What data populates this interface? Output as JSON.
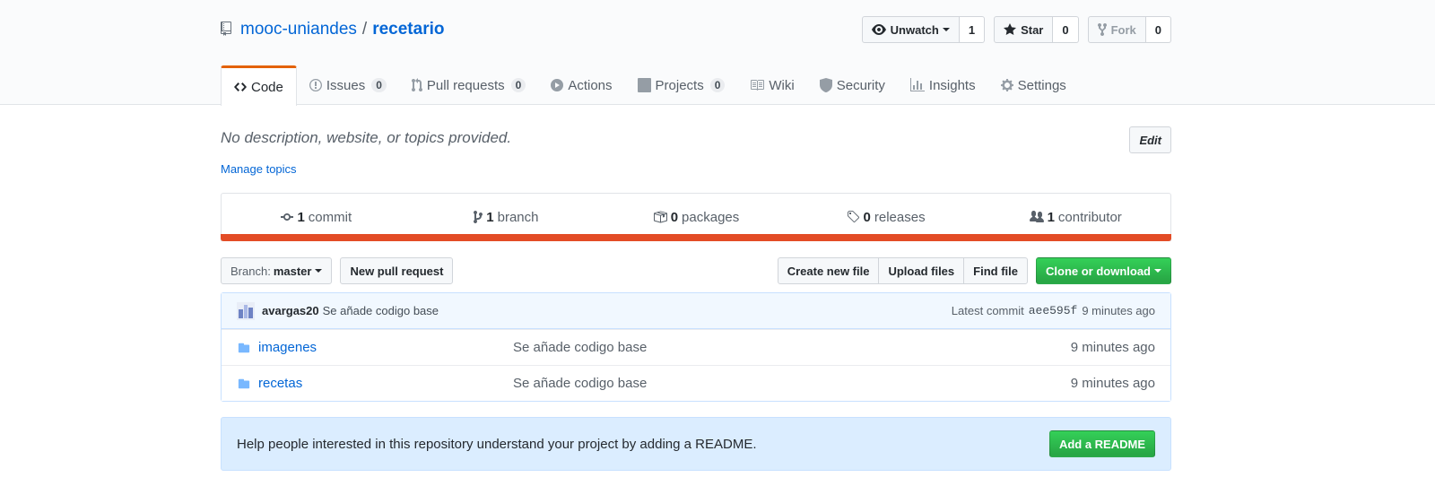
{
  "repo": {
    "owner": "mooc-uniandes",
    "separator": "/",
    "name": "recetario"
  },
  "actions": {
    "watch": {
      "label": "Unwatch",
      "count": "1"
    },
    "star": {
      "label": "Star",
      "count": "0"
    },
    "fork": {
      "label": "Fork",
      "count": "0"
    }
  },
  "tabs": [
    {
      "label": "Code",
      "icon": "code-icon",
      "selected": true
    },
    {
      "label": "Issues",
      "count": "0",
      "icon": "issue-icon"
    },
    {
      "label": "Pull requests",
      "count": "0",
      "icon": "pull-request-icon"
    },
    {
      "label": "Actions",
      "icon": "play-icon"
    },
    {
      "label": "Projects",
      "count": "0",
      "icon": "project-icon"
    },
    {
      "label": "Wiki",
      "icon": "book-icon"
    },
    {
      "label": "Security",
      "icon": "shield-icon"
    },
    {
      "label": "Insights",
      "icon": "graph-icon"
    },
    {
      "label": "Settings",
      "icon": "gear-icon"
    }
  ],
  "description": {
    "text": "No description, website, or topics provided.",
    "edit_label": "Edit",
    "manage_topics": "Manage topics"
  },
  "summary": {
    "commits": {
      "num": "1",
      "label": "commit"
    },
    "branches": {
      "num": "1",
      "label": "branch"
    },
    "packages": {
      "num": "0",
      "label": "packages"
    },
    "releases": {
      "num": "0",
      "label": "releases"
    },
    "contributors": {
      "num": "1",
      "label": "contributor"
    }
  },
  "language_bar_color": "#e34c26",
  "file_nav": {
    "branch_prefix": "Branch:",
    "branch_name": "master",
    "new_pr": "New pull request",
    "create_file": "Create new file",
    "upload_files": "Upload files",
    "find_file": "Find file",
    "clone": "Clone or download"
  },
  "latest_commit": {
    "author": "avargas20",
    "message": "Se añade codigo base",
    "prefix": "Latest commit",
    "sha": "aee595f",
    "age": "9 minutes ago"
  },
  "files": [
    {
      "name": "imagenes",
      "message": "Se añade codigo base",
      "age": "9 minutes ago"
    },
    {
      "name": "recetas",
      "message": "Se añade codigo base",
      "age": "9 minutes ago"
    }
  ],
  "readme": {
    "text": "Help people interested in this repository understand your project by adding a README.",
    "button": "Add a README"
  },
  "colors": {
    "accent": "#0366d6",
    "green": "#28a745",
    "tab_highlight": "#e36209"
  }
}
